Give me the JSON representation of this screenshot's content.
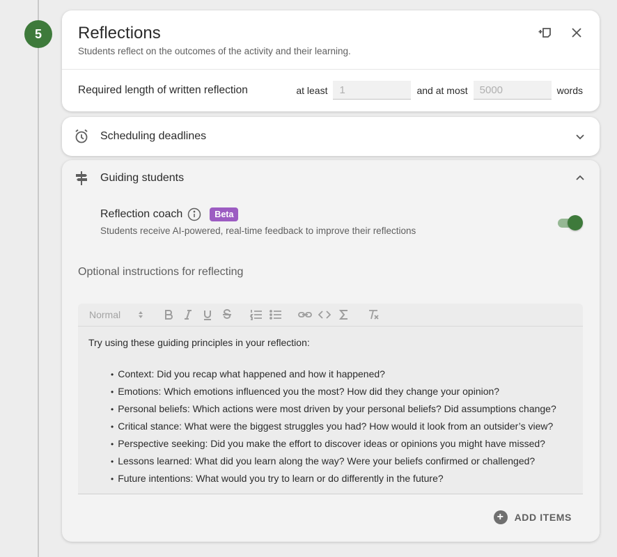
{
  "step": {
    "number": "5"
  },
  "reflections": {
    "title": "Reflections",
    "subtitle": "Students reflect on the outcomes of the activity and their learning.",
    "required_length_label": "Required length of written reflection",
    "at_least_label": "at least",
    "min_placeholder": "1",
    "and_at_most_label": "and at most",
    "max_placeholder": "5000",
    "words_label": "words"
  },
  "scheduling": {
    "title": "Scheduling deadlines",
    "icon": "alarm-clock-icon"
  },
  "guiding": {
    "title": "Guiding students",
    "icon": "signpost-icon",
    "coach": {
      "title": "Reflection coach",
      "badge": "Beta",
      "description": "Students receive AI-powered, real-time feedback to improve their reflections",
      "enabled": true
    },
    "optional_label": "Optional instructions for reflecting",
    "editor": {
      "format_select": "Normal",
      "intro": "Try using these guiding principles in your reflection:",
      "bullets": [
        "Context: Did you recap what happened and how it happened?",
        "Emotions: Which emotions influenced you the most? How did they change your opinion?",
        "Personal beliefs: Which actions were most driven by your personal beliefs? Did assumptions change?",
        "Critical stance: What were the biggest struggles you had? How would it look from an outsider’s view?",
        "Perspective seeking: Did you make the effort to discover ideas or opinions you might have missed?",
        "Lessons learned: What did you learn along the way? Were your beliefs confirmed or challenged?",
        "Future intentions: What would you try to learn or do differently in the future?"
      ]
    },
    "add_items_label": "ADD ITEMS"
  },
  "colors": {
    "accent_green": "#3e7a3b",
    "beta_purple": "#9c5cc2"
  }
}
